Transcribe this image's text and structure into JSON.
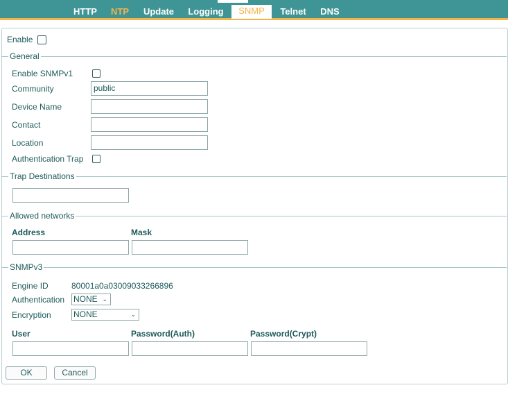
{
  "tabs": [
    {
      "label": "HTTP"
    },
    {
      "label": "NTP"
    },
    {
      "label": "Update"
    },
    {
      "label": "Logging"
    },
    {
      "label": "SNMP"
    },
    {
      "label": "Telnet"
    },
    {
      "label": "DNS"
    }
  ],
  "form": {
    "enable_label": "Enable",
    "general": {
      "title": "General",
      "enable_snmpv1_label": "Enable SNMPv1",
      "community_label": "Community",
      "community_value": "public",
      "device_name_label": "Device Name",
      "device_name_value": "",
      "contact_label": "Contact",
      "contact_value": "",
      "location_label": "Location",
      "location_value": "",
      "auth_trap_label": "Authentication Trap"
    },
    "trap_destinations": {
      "title": "Trap Destinations",
      "value": ""
    },
    "allowed_networks": {
      "title": "Allowed networks",
      "address_header": "Address",
      "mask_header": "Mask",
      "address_value": "",
      "mask_value": ""
    },
    "snmpv3": {
      "title": "SNMPv3",
      "engine_id_label": "Engine ID",
      "engine_id_value": "80001a0a03009033266896",
      "authentication_label": "Authentication",
      "authentication_value": "NONE",
      "encryption_label": "Encryption",
      "encryption_value": "NONE",
      "user_header": "User",
      "password_auth_header": "Password(Auth)",
      "password_crypt_header": "Password(Crypt)"
    },
    "ok_label": "OK",
    "cancel_label": "Cancel"
  },
  "colors": {
    "tabbar": "#3f9596",
    "accent": "#f3b44a",
    "text": "#1f5a5a"
  }
}
